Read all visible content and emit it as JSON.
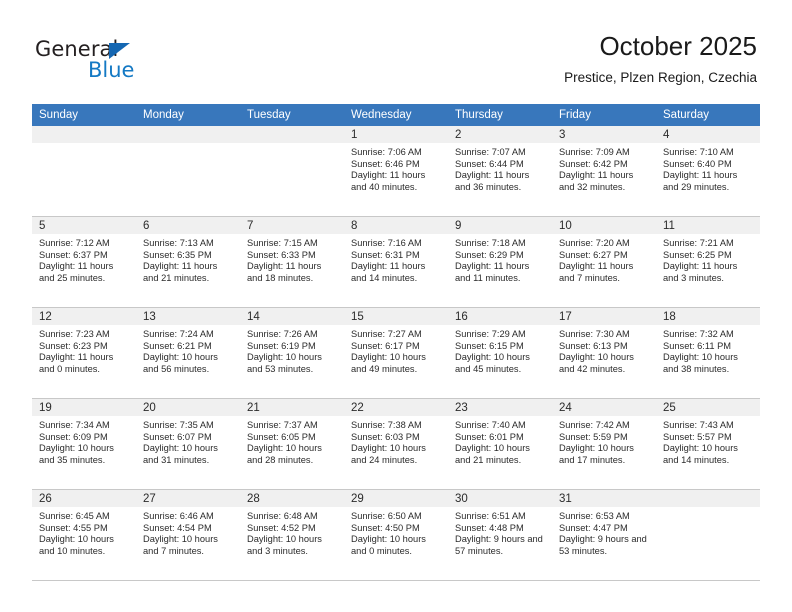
{
  "brand": {
    "name_top": "General",
    "name_bottom": "Blue",
    "accent_color": "#1479c4",
    "triangle_color": "#1567b2"
  },
  "header": {
    "title": "October 2025",
    "subtitle": "Prestice, Plzen Region, Czechia"
  },
  "calendar": {
    "header_bg": "#3877bc",
    "header_text_color": "#ffffff",
    "daynum_bg": "#f0f0f0",
    "grid_line_color": "#c8c8c8",
    "weekdays": [
      "Sunday",
      "Monday",
      "Tuesday",
      "Wednesday",
      "Thursday",
      "Friday",
      "Saturday"
    ],
    "weeks": [
      [
        {
          "day": "",
          "empty": true
        },
        {
          "day": "",
          "empty": true
        },
        {
          "day": "",
          "empty": true
        },
        {
          "day": "1",
          "sunrise": "Sunrise: 7:06 AM",
          "sunset": "Sunset: 6:46 PM",
          "daylight": "Daylight: 11 hours and 40 minutes."
        },
        {
          "day": "2",
          "sunrise": "Sunrise: 7:07 AM",
          "sunset": "Sunset: 6:44 PM",
          "daylight": "Daylight: 11 hours and 36 minutes."
        },
        {
          "day": "3",
          "sunrise": "Sunrise: 7:09 AM",
          "sunset": "Sunset: 6:42 PM",
          "daylight": "Daylight: 11 hours and 32 minutes."
        },
        {
          "day": "4",
          "sunrise": "Sunrise: 7:10 AM",
          "sunset": "Sunset: 6:40 PM",
          "daylight": "Daylight: 11 hours and 29 minutes."
        }
      ],
      [
        {
          "day": "5",
          "sunrise": "Sunrise: 7:12 AM",
          "sunset": "Sunset: 6:37 PM",
          "daylight": "Daylight: 11 hours and 25 minutes."
        },
        {
          "day": "6",
          "sunrise": "Sunrise: 7:13 AM",
          "sunset": "Sunset: 6:35 PM",
          "daylight": "Daylight: 11 hours and 21 minutes."
        },
        {
          "day": "7",
          "sunrise": "Sunrise: 7:15 AM",
          "sunset": "Sunset: 6:33 PM",
          "daylight": "Daylight: 11 hours and 18 minutes."
        },
        {
          "day": "8",
          "sunrise": "Sunrise: 7:16 AM",
          "sunset": "Sunset: 6:31 PM",
          "daylight": "Daylight: 11 hours and 14 minutes."
        },
        {
          "day": "9",
          "sunrise": "Sunrise: 7:18 AM",
          "sunset": "Sunset: 6:29 PM",
          "daylight": "Daylight: 11 hours and 11 minutes."
        },
        {
          "day": "10",
          "sunrise": "Sunrise: 7:20 AM",
          "sunset": "Sunset: 6:27 PM",
          "daylight": "Daylight: 11 hours and 7 minutes."
        },
        {
          "day": "11",
          "sunrise": "Sunrise: 7:21 AM",
          "sunset": "Sunset: 6:25 PM",
          "daylight": "Daylight: 11 hours and 3 minutes."
        }
      ],
      [
        {
          "day": "12",
          "sunrise": "Sunrise: 7:23 AM",
          "sunset": "Sunset: 6:23 PM",
          "daylight": "Daylight: 11 hours and 0 minutes."
        },
        {
          "day": "13",
          "sunrise": "Sunrise: 7:24 AM",
          "sunset": "Sunset: 6:21 PM",
          "daylight": "Daylight: 10 hours and 56 minutes."
        },
        {
          "day": "14",
          "sunrise": "Sunrise: 7:26 AM",
          "sunset": "Sunset: 6:19 PM",
          "daylight": "Daylight: 10 hours and 53 minutes."
        },
        {
          "day": "15",
          "sunrise": "Sunrise: 7:27 AM",
          "sunset": "Sunset: 6:17 PM",
          "daylight": "Daylight: 10 hours and 49 minutes."
        },
        {
          "day": "16",
          "sunrise": "Sunrise: 7:29 AM",
          "sunset": "Sunset: 6:15 PM",
          "daylight": "Daylight: 10 hours and 45 minutes."
        },
        {
          "day": "17",
          "sunrise": "Sunrise: 7:30 AM",
          "sunset": "Sunset: 6:13 PM",
          "daylight": "Daylight: 10 hours and 42 minutes."
        },
        {
          "day": "18",
          "sunrise": "Sunrise: 7:32 AM",
          "sunset": "Sunset: 6:11 PM",
          "daylight": "Daylight: 10 hours and 38 minutes."
        }
      ],
      [
        {
          "day": "19",
          "sunrise": "Sunrise: 7:34 AM",
          "sunset": "Sunset: 6:09 PM",
          "daylight": "Daylight: 10 hours and 35 minutes."
        },
        {
          "day": "20",
          "sunrise": "Sunrise: 7:35 AM",
          "sunset": "Sunset: 6:07 PM",
          "daylight": "Daylight: 10 hours and 31 minutes."
        },
        {
          "day": "21",
          "sunrise": "Sunrise: 7:37 AM",
          "sunset": "Sunset: 6:05 PM",
          "daylight": "Daylight: 10 hours and 28 minutes."
        },
        {
          "day": "22",
          "sunrise": "Sunrise: 7:38 AM",
          "sunset": "Sunset: 6:03 PM",
          "daylight": "Daylight: 10 hours and 24 minutes."
        },
        {
          "day": "23",
          "sunrise": "Sunrise: 7:40 AM",
          "sunset": "Sunset: 6:01 PM",
          "daylight": "Daylight: 10 hours and 21 minutes."
        },
        {
          "day": "24",
          "sunrise": "Sunrise: 7:42 AM",
          "sunset": "Sunset: 5:59 PM",
          "daylight": "Daylight: 10 hours and 17 minutes."
        },
        {
          "day": "25",
          "sunrise": "Sunrise: 7:43 AM",
          "sunset": "Sunset: 5:57 PM",
          "daylight": "Daylight: 10 hours and 14 minutes."
        }
      ],
      [
        {
          "day": "26",
          "sunrise": "Sunrise: 6:45 AM",
          "sunset": "Sunset: 4:55 PM",
          "daylight": "Daylight: 10 hours and 10 minutes."
        },
        {
          "day": "27",
          "sunrise": "Sunrise: 6:46 AM",
          "sunset": "Sunset: 4:54 PM",
          "daylight": "Daylight: 10 hours and 7 minutes."
        },
        {
          "day": "28",
          "sunrise": "Sunrise: 6:48 AM",
          "sunset": "Sunset: 4:52 PM",
          "daylight": "Daylight: 10 hours and 3 minutes."
        },
        {
          "day": "29",
          "sunrise": "Sunrise: 6:50 AM",
          "sunset": "Sunset: 4:50 PM",
          "daylight": "Daylight: 10 hours and 0 minutes."
        },
        {
          "day": "30",
          "sunrise": "Sunrise: 6:51 AM",
          "sunset": "Sunset: 4:48 PM",
          "daylight": "Daylight: 9 hours and 57 minutes."
        },
        {
          "day": "31",
          "sunrise": "Sunrise: 6:53 AM",
          "sunset": "Sunset: 4:47 PM",
          "daylight": "Daylight: 9 hours and 53 minutes."
        },
        {
          "day": "",
          "empty": true
        }
      ]
    ]
  }
}
